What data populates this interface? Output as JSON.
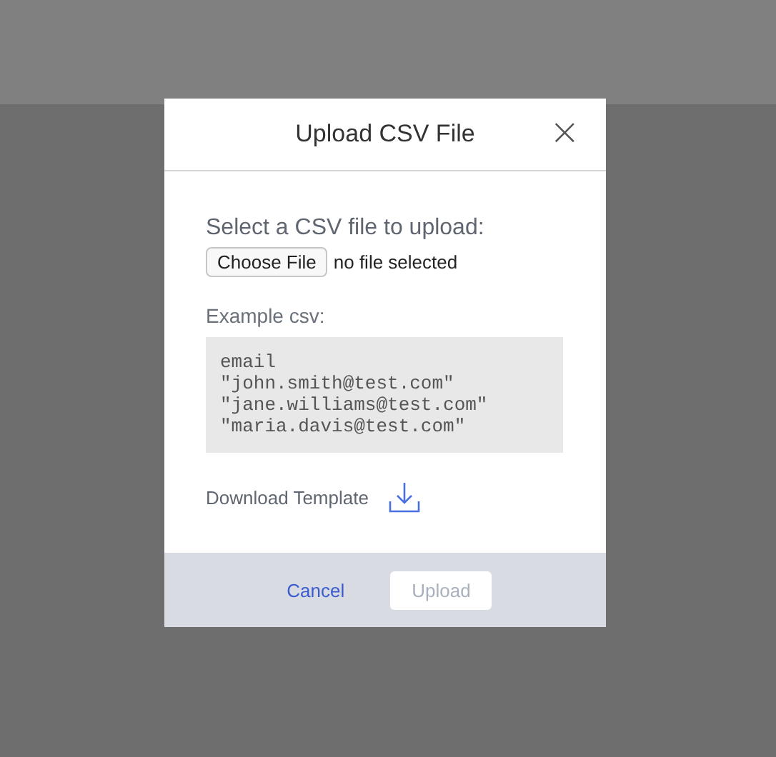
{
  "dialog": {
    "title": "Upload CSV File",
    "close": "×"
  },
  "file_prompt": "Select a CSV file to upload:",
  "file_input": {
    "button": "Choose File",
    "status": "no file selected"
  },
  "example_label": "Example csv:",
  "example_lines": [
    "email",
    "\"john.smith@test.com\"",
    "\"jane.williams@test.com\"",
    "\"maria.davis@test.com\""
  ],
  "download_link": "Download Template",
  "buttons": [
    {
      "label": "Cancel",
      "kind": "link",
      "disabled": false
    },
    {
      "label": "Upload",
      "kind": "primary",
      "disabled": true
    }
  ]
}
